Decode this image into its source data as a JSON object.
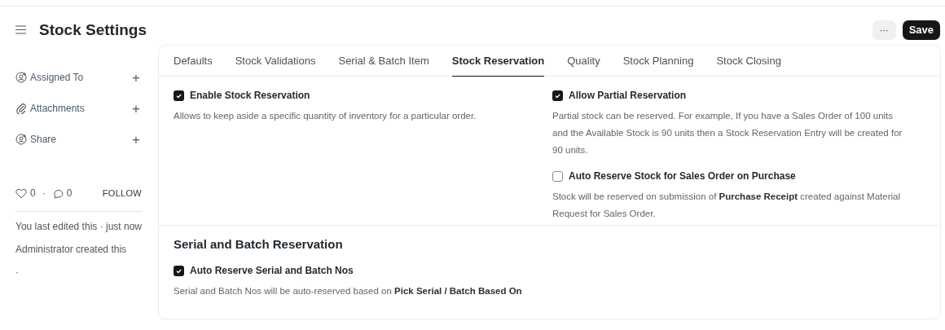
{
  "page": {
    "title": "Stock Settings"
  },
  "actions": {
    "more": "···",
    "save": "Save"
  },
  "sidebar": {
    "items": [
      {
        "kind": "assign",
        "label": "Assigned To",
        "add": "+"
      },
      {
        "kind": "attach",
        "label": "Attachments",
        "add": "+"
      },
      {
        "kind": "share",
        "label": "Share",
        "add": "+"
      }
    ],
    "likes": "0",
    "separator": "·",
    "comments": "0",
    "follow": "FOLLOW",
    "activity": [
      "You last edited this · just now",
      "Administrator created this",
      "·"
    ]
  },
  "tabs": [
    {
      "label": "Defaults",
      "selected": false
    },
    {
      "label": "Stock Validations",
      "selected": false
    },
    {
      "label": "Serial & Batch Item",
      "selected": false
    },
    {
      "label": "Stock Reservation",
      "selected": true
    },
    {
      "label": "Quality",
      "selected": false
    },
    {
      "label": "Stock Planning",
      "selected": false
    },
    {
      "label": "Stock Closing",
      "selected": false
    }
  ],
  "sections": [
    {
      "columns": [
        [
          {
            "label": "Enable Stock Reservation",
            "checked": true,
            "description": "Allows to keep aside a specific quantity of inventory for a particular order."
          }
        ],
        [
          {
            "label": "Allow Partial Reservation",
            "checked": true,
            "description": "Partial stock can be reserved. For example, If you have a Sales Order of 100 units and the Available Stock is 90 units then a Stock Reservation Entry will be created for 90 units."
          },
          {
            "label": "Auto Reserve Stock for Sales Order on Purchase",
            "checked": false,
            "description": "Stock will be reserved on submission of **Purchase Receipt** created against Material Request for Sales Order."
          }
        ]
      ]
    },
    {
      "heading": "Serial and Batch Reservation",
      "columns": [
        [
          {
            "label": "Auto Reserve Serial and Batch Nos",
            "checked": true,
            "description": "Serial and Batch Nos will be auto-reserved based on **Pick Serial / Batch Based On**"
          }
        ],
        []
      ]
    }
  ]
}
